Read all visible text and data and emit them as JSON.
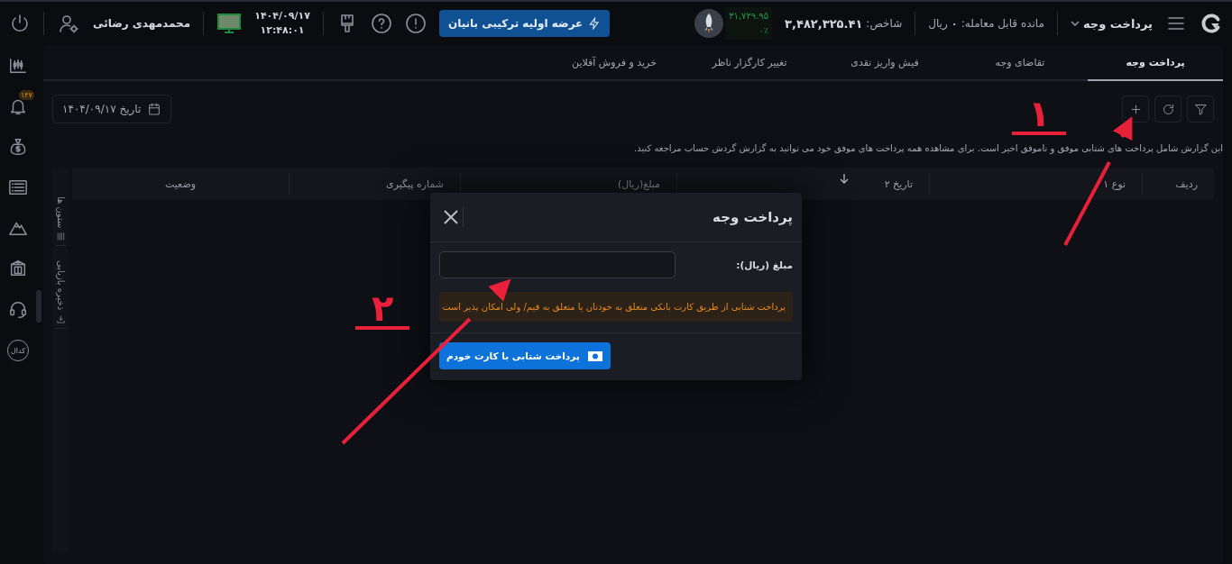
{
  "top_bar": {
    "menu_title": "پرداخت وجه",
    "balance": "مانده قابل معامله: **۰** ریال",
    "index_label": "شاخص:",
    "index_value": "۳,۴۸۲,۳۲۵.۴۱",
    "index_change": "۳۱,۷۲۹.۹۵",
    "index_change_percent": "۰٪",
    "ipo_button": "عرضه اولیه ترکیبی بانیان",
    "date": "۱۴۰۴/۰۹/۱۷",
    "time": "۱۲:۴۸:۰۱",
    "user_name": "محمدمهدی رضائی"
  },
  "sidebar": {
    "notification_badge": "۱۴۷",
    "codal_label": "کدال"
  },
  "tabs": [
    {
      "label": "پرداخت وجه",
      "selected": true
    },
    {
      "label": "تقاضای وجه",
      "selected": false
    },
    {
      "label": "فیش واریز نقدی",
      "selected": false
    },
    {
      "label": "تغییر کارگزار ناظر",
      "selected": false
    },
    {
      "label": "خرید و فروش آفلاین",
      "selected": false
    }
  ],
  "date_filter": "تاریخ ۱۴۰۴/۰۹/۱۷",
  "notice": "این گزارش شامل پرداخت های شتابی موفق و ناموفق اخیر است. برای مشاهده همه پرداخت های موفق خود می توانید به گزارش گردش حساب مراجعه کنید.",
  "table": {
    "columns": [
      {
        "label": "ردیف",
        "sorted": false
      },
      {
        "label": "نوع ۱",
        "sorted": false
      },
      {
        "label": "تاریخ ۲",
        "sorted": true
      },
      {
        "label": "مبلغ(ریال)",
        "sorted": false
      },
      {
        "label": "شماره پیگیری",
        "sorted": false
      },
      {
        "label": "وضعیت",
        "sorted": false
      }
    ]
  },
  "side_strip": [
    "ستون ها",
    "ذخیره بازیابی"
  ],
  "modal": {
    "title": "پرداخت وجه",
    "amount_label": "مبلغ (ریال):",
    "warning": "پرداخت شتابی از طریق کارت بانکی متعلق به خودتان یا متعلق به قیم/ ولی امکان پذیر است",
    "submit_button": "پرداخت شتابی با کارت خودم"
  },
  "annotations": [
    {
      "label": "۱"
    },
    {
      "label": "۲"
    }
  ]
}
